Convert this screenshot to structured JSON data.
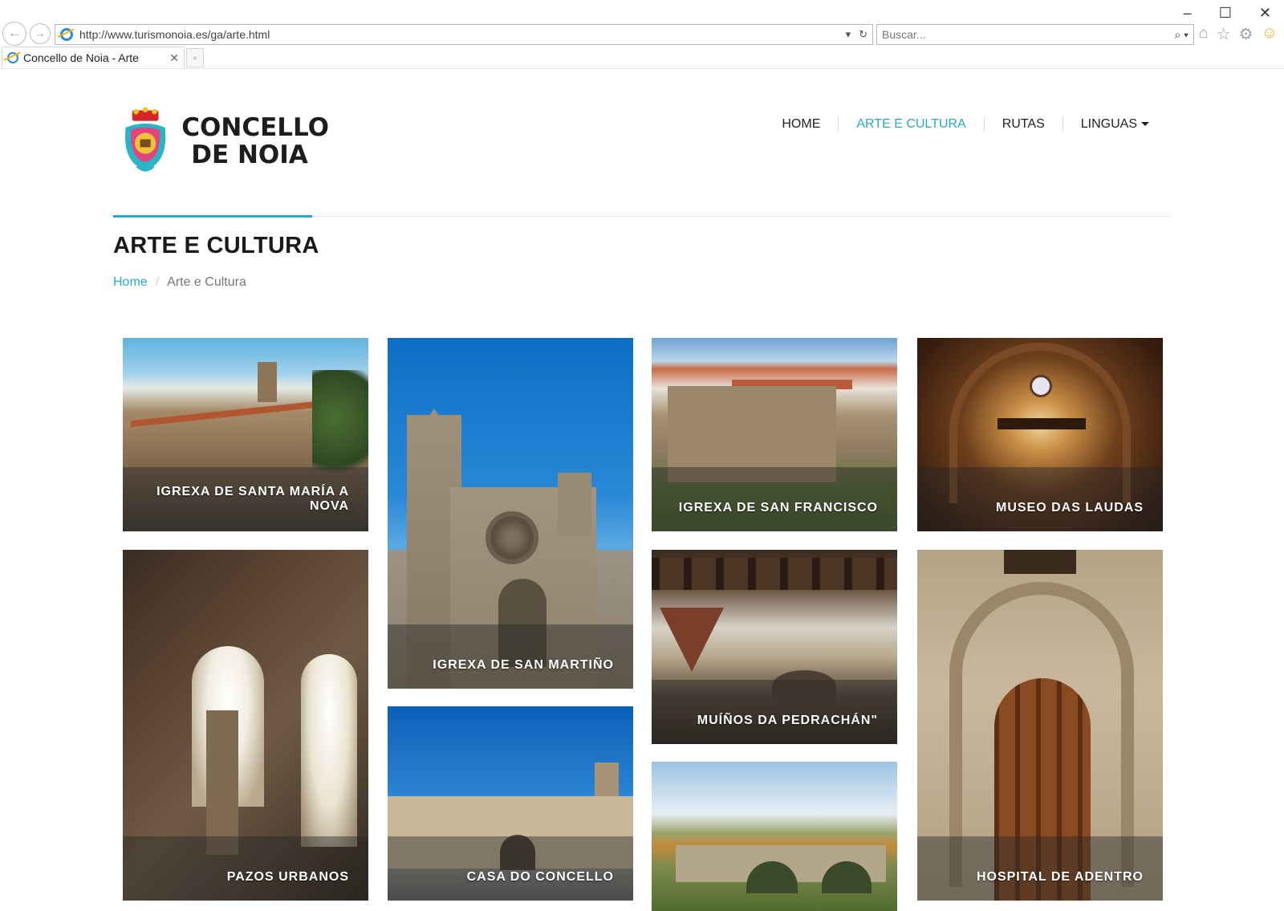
{
  "browser": {
    "url": "http://www.turismonoia.es/ga/arte.html",
    "search_placeholder": "Buscar...",
    "tab_title": "Concello de Noia - Arte",
    "window_controls": [
      "minimize",
      "maximize",
      "close"
    ],
    "toolbar_icons": [
      "home-icon",
      "favorites-star-icon",
      "settings-gear-icon",
      "feedback-smiley-icon"
    ]
  },
  "site": {
    "logo_line1": "CONCELLO",
    "logo_line2": "DE NOIA",
    "nav": [
      {
        "label": "HOME"
      },
      {
        "label": "ARTE E CULTURA",
        "active": true
      },
      {
        "label": "RUTAS"
      },
      {
        "label": "LINGUAS"
      }
    ],
    "accent_color": "#29a9c5"
  },
  "page": {
    "title": "ARTE E CULTURA",
    "breadcrumb_home": "Home",
    "breadcrumb_separator": "/",
    "breadcrumb_current": "Arte e Cultura"
  },
  "gallery": [
    {
      "caption": "IGREXA DE SANTA MARÍA A NOVA"
    },
    {
      "caption": "IGREXA DE SAN MARTIÑO"
    },
    {
      "caption": "IGREXA DE SAN FRANCISCO"
    },
    {
      "caption": "MUSEO DAS LAUDAS"
    },
    {
      "caption": "PAZOS URBANOS"
    },
    {
      "caption": "CASA DO CONCELLO"
    },
    {
      "caption": "MUÍÑOS DA PEDRACHÁN\""
    },
    {
      "caption": ""
    },
    {
      "caption": "HOSPITAL DE ADENTRO"
    }
  ]
}
